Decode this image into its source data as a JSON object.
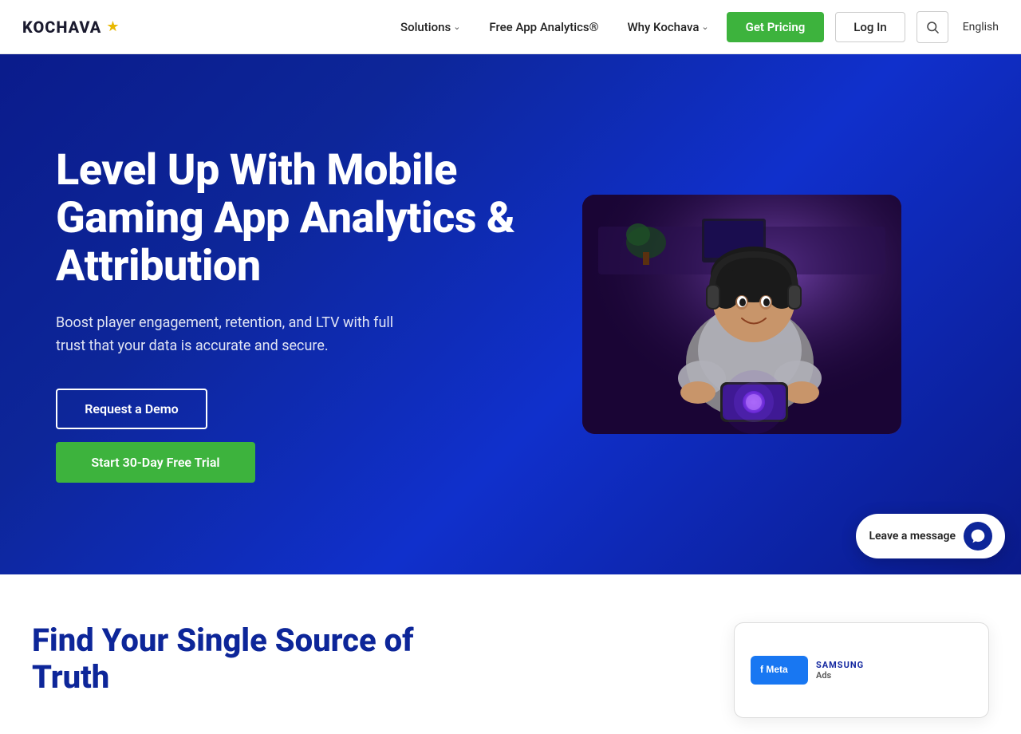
{
  "brand": {
    "name": "KOCHAVA",
    "star": "★"
  },
  "nav": {
    "solutions_label": "Solutions",
    "analytics_label": "Free App Analytics®",
    "why_label": "Why Kochava",
    "get_pricing_label": "Get Pricing",
    "login_label": "Log In",
    "language_label": "English"
  },
  "hero": {
    "title": "Level Up With Mobile Gaming App Analytics & Attribution",
    "subtitle": "Boost player engagement, retention, and LTV with full trust that your data is accurate and secure.",
    "cta_demo": "Request a Demo",
    "cta_trial": "Start 30-Day Free Trial"
  },
  "section2": {
    "title": "Find Your Single Source of Truth"
  },
  "ad_panel": {
    "meta_label": "f Meta",
    "samsung_label": "SAMSUNG",
    "ads_label": "Ads"
  },
  "chat": {
    "label": "Leave a message"
  }
}
